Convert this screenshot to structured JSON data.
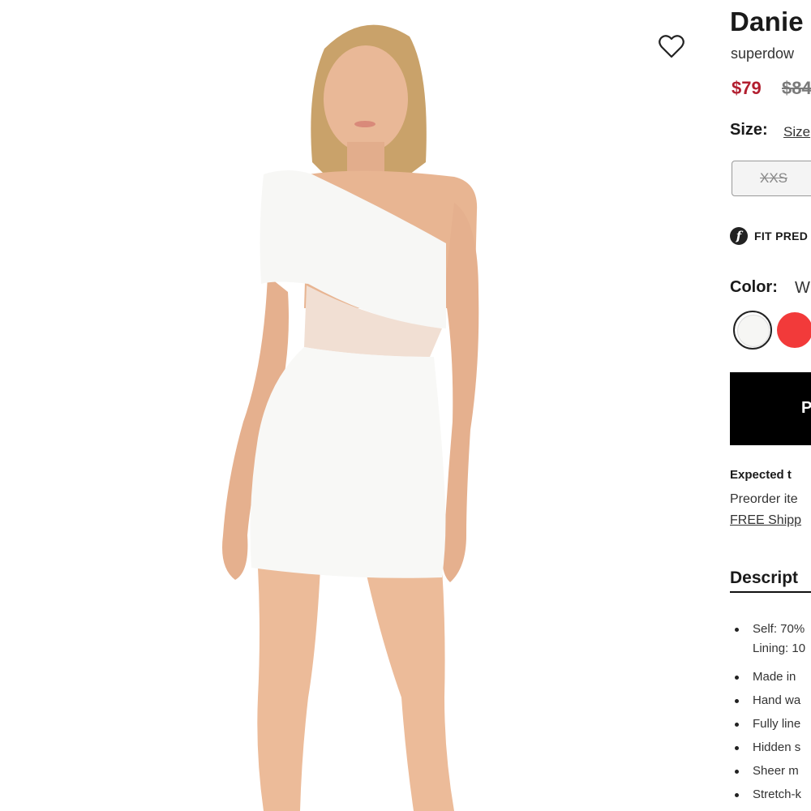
{
  "product": {
    "title": "Danie",
    "brand": "superdow",
    "price_sale": "$79",
    "price_original": "$84"
  },
  "size": {
    "label": "Size:",
    "guide_link": "Size",
    "options": [
      {
        "label": "XXS",
        "available": false
      }
    ]
  },
  "fit_predictor": {
    "icon_letter": "f",
    "label": "FIT PRED"
  },
  "color": {
    "label": "Color:",
    "value": "W",
    "swatches": [
      {
        "name": "white",
        "hex": "#f6f6f4",
        "selected": true
      },
      {
        "name": "red",
        "hex": "#f23a3a",
        "selected": false
      }
    ]
  },
  "cta": {
    "label": "P"
  },
  "delivery": {
    "expected": "Expected t",
    "preorder": "Preorder ite",
    "shipping_link": "FREE Shipp"
  },
  "description": {
    "title": "Descript",
    "bullets": [
      [
        "Self: 70%",
        "Lining: 10"
      ],
      [
        "Made in"
      ],
      [
        "Hand wa"
      ],
      [
        "Fully line"
      ],
      [
        "Hidden s"
      ],
      [
        "Sheer m"
      ],
      [
        "Stretch-k"
      ]
    ]
  },
  "icons": {
    "wishlist": "heart-outline-icon"
  },
  "colors": {
    "sale_price": "#b21e2f",
    "cta_background": "#000000"
  }
}
